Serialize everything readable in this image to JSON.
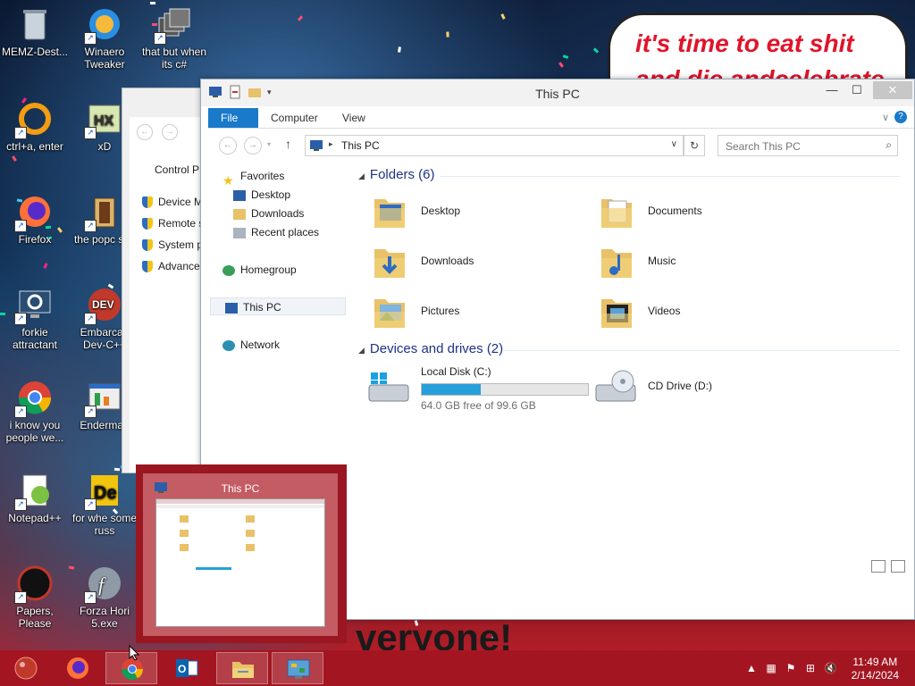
{
  "desktop": {
    "banner_line1": "it's time to eat shit",
    "banner_line2": "and die andcelebrate",
    "bottom_text": "veryone!",
    "icons": [
      {
        "label": "MEMZ-Dest...",
        "icon": "recycle-bin-icon"
      },
      {
        "label": "Winaero Tweaker",
        "icon": "winaero-icon"
      },
      {
        "label": "that but when its c#",
        "icon": "stack-windows-icon"
      },
      {
        "label": "ctrl+a, enter",
        "icon": "orange-ring-icon"
      },
      {
        "label": "xD",
        "icon": "hxd-icon"
      },
      {
        "label": "Firefox",
        "icon": "firefox-icon"
      },
      {
        "label": "the popc shit",
        "icon": "popcorn-icon"
      },
      {
        "label": "forkie attractant",
        "icon": "monitor-gear-icon"
      },
      {
        "label": "Embarcad Dev-C++",
        "icon": "devcpp-icon"
      },
      {
        "label": "i know you people we...",
        "icon": "chrome-icon"
      },
      {
        "label": "Enderman",
        "icon": "window-chart-icon"
      },
      {
        "label": "Notepad++",
        "icon": "notepadpp-icon"
      },
      {
        "label": "for whe some russ",
        "icon": "de-icon"
      },
      {
        "label": "Papers, Please",
        "icon": "papers-please-icon"
      },
      {
        "label": "Forza Hori 5.exe",
        "icon": "flash-icon"
      }
    ]
  },
  "control_panel": {
    "title": "Control P",
    "items": [
      "Device Ma",
      "Remote se",
      "System pr",
      "Advanced"
    ]
  },
  "explorer": {
    "title": "This PC",
    "tabs": [
      {
        "label": "File"
      },
      {
        "label": "Computer"
      },
      {
        "label": "View"
      }
    ],
    "address": "This PC",
    "search_placeholder": "Search This PC",
    "nav": {
      "favorites": "Favorites",
      "favorites_items": [
        "Desktop",
        "Downloads",
        "Recent places"
      ],
      "homegroup": "Homegroup",
      "thispc": "This PC",
      "network": "Network"
    },
    "folders_header": "Folders (6)",
    "folders": [
      "Desktop",
      "Documents",
      "Downloads",
      "Music",
      "Pictures",
      "Videos"
    ],
    "devices_header": "Devices and drives (2)",
    "drives": [
      {
        "label": "Local Disk (C:)",
        "free": "64.0 GB free of 99.6 GB",
        "used_fraction": 0.357
      },
      {
        "label": "CD Drive (D:)"
      }
    ]
  },
  "thumbnail": {
    "title": "This PC"
  },
  "taskbar": {
    "apps": [
      "start-orb-icon",
      "firefox-icon",
      "chrome-icon",
      "outlook-icon",
      "file-explorer-icon",
      "control-panel-icon"
    ],
    "time": "11:49 AM",
    "date": "2/14/2024"
  },
  "colors": {
    "accent": "#1979ca",
    "taskbar": "#a31621",
    "drive_bar": "#26a0da"
  }
}
